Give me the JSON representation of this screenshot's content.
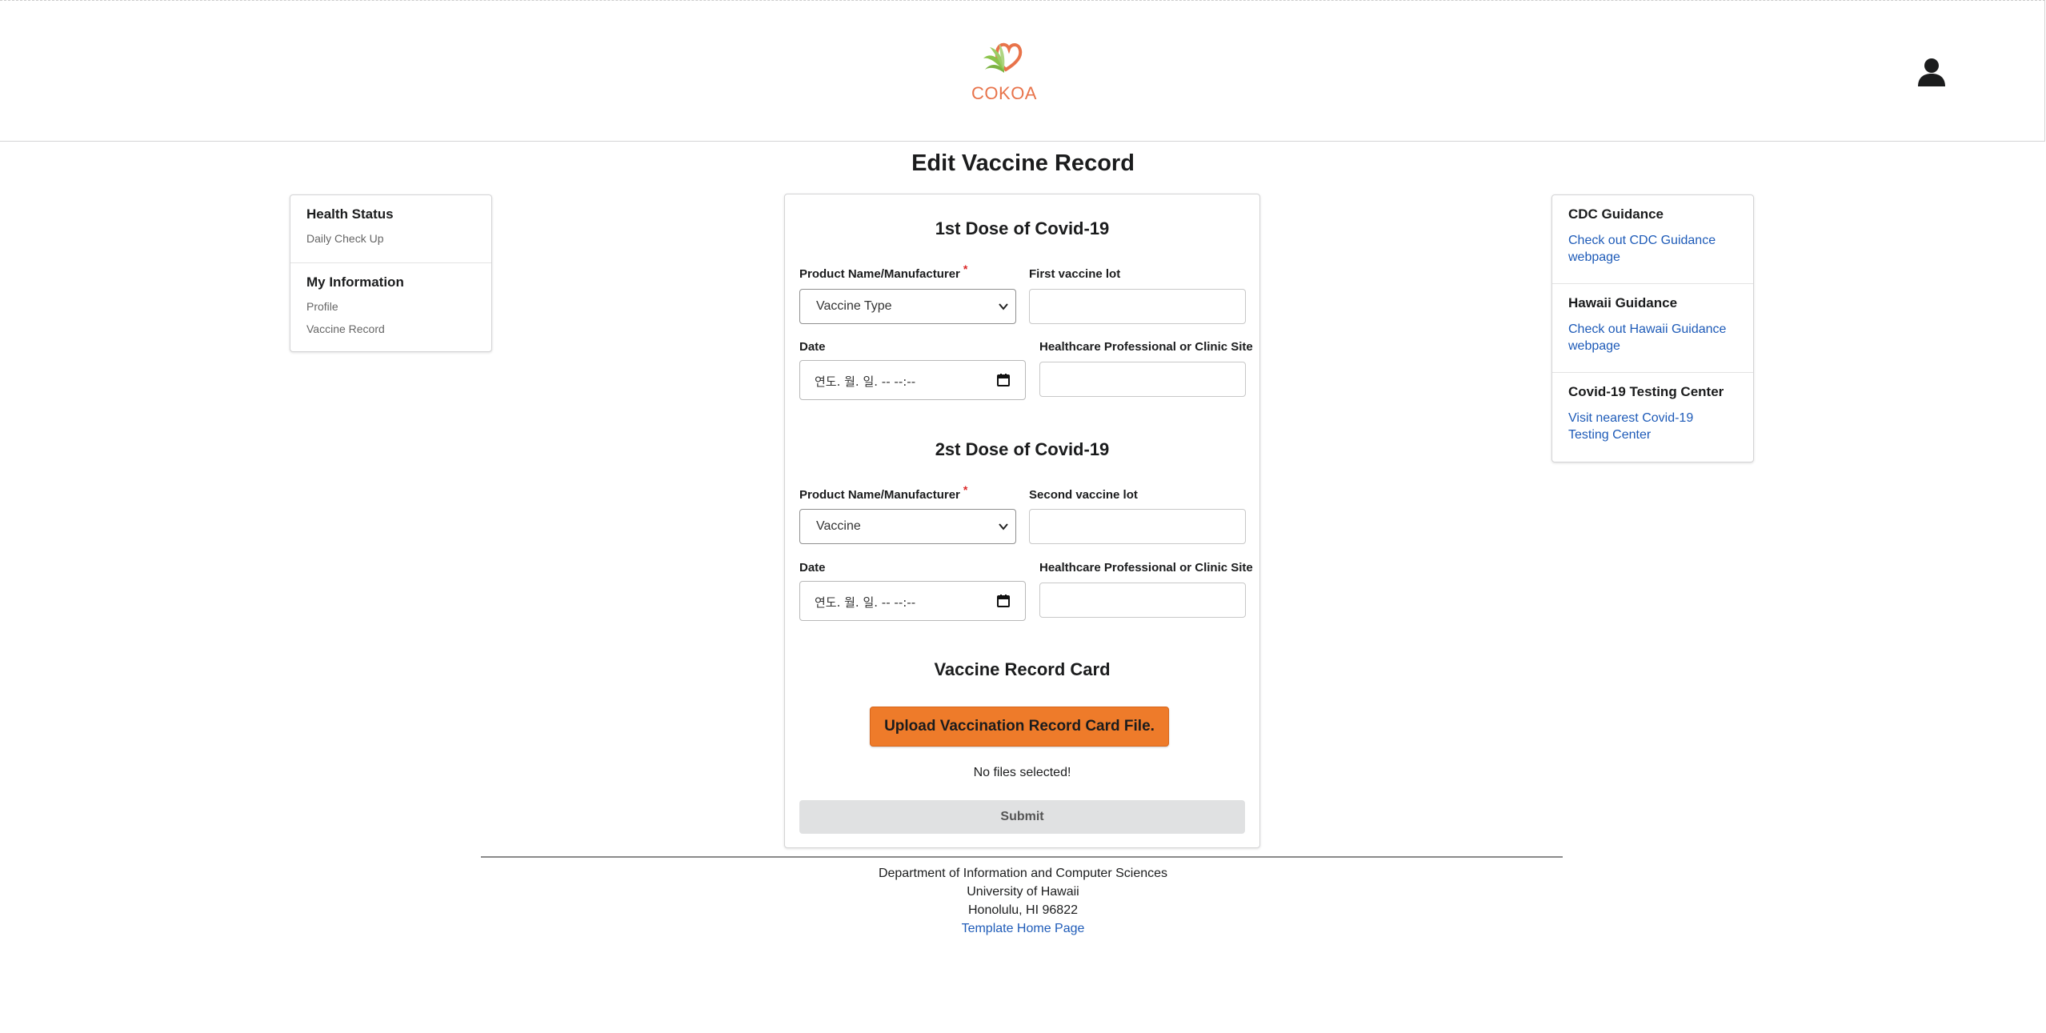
{
  "header": {
    "logo_text": "COKOA",
    "logo_icon": "cokoa-leaf-heart-logo",
    "user_icon": "user-icon"
  },
  "page": {
    "title": "Edit Vaccine Record"
  },
  "left_menu": {
    "sections": [
      {
        "heading": "Health Status",
        "items": [
          "Daily Check Up"
        ]
      },
      {
        "heading": "My Information",
        "items": [
          "Profile",
          "Vaccine Record"
        ]
      }
    ]
  },
  "right_menu": {
    "sections": [
      {
        "heading": "CDC Guidance",
        "link": "Check out CDC Guidance webpage"
      },
      {
        "heading": "Hawaii Guidance",
        "link": "Check out Hawaii Guidance webpage"
      },
      {
        "heading": "Covid-19 Testing Center",
        "link": "Visit nearest Covid-19 Testing Center"
      }
    ]
  },
  "form": {
    "dose1": {
      "title": "1st Dose of Covid-19",
      "product_label": "Product Name/Manufacturer",
      "product_required_mark": "*",
      "product_value": "Vaccine Type",
      "lot_label": "First vaccine lot",
      "lot_value": "",
      "date_label": "Date",
      "date_value": "연도. 월. 일. -- --:--",
      "clinic_label": "Healthcare Professional or Clinic Site",
      "clinic_value": ""
    },
    "dose2": {
      "title": "2st Dose of Covid-19",
      "product_label": "Product Name/Manufacturer",
      "product_required_mark": "*",
      "product_value": "Vaccine",
      "lot_label": "Second vaccine lot",
      "lot_value": "",
      "date_label": "Date",
      "date_value": "연도. 월. 일. -- --:--",
      "clinic_label": "Healthcare Professional or Clinic Site",
      "clinic_value": ""
    },
    "card": {
      "title": "Vaccine Record Card",
      "upload_label": "Upload Vaccination Record Card File.",
      "no_files": "No files selected!",
      "submit_label": "Submit"
    }
  },
  "footer": {
    "line1": "Department of Information and Computer Sciences",
    "line2": "University of Hawaii",
    "line3": "Honolulu, HI 96822",
    "link": "Template Home Page"
  },
  "colors": {
    "accent_orange": "#ee7b2a",
    "link_blue": "#1e5bb8",
    "logo_orange": "#e8734a",
    "logo_green": "#7cb342",
    "required_red": "#db2828"
  }
}
